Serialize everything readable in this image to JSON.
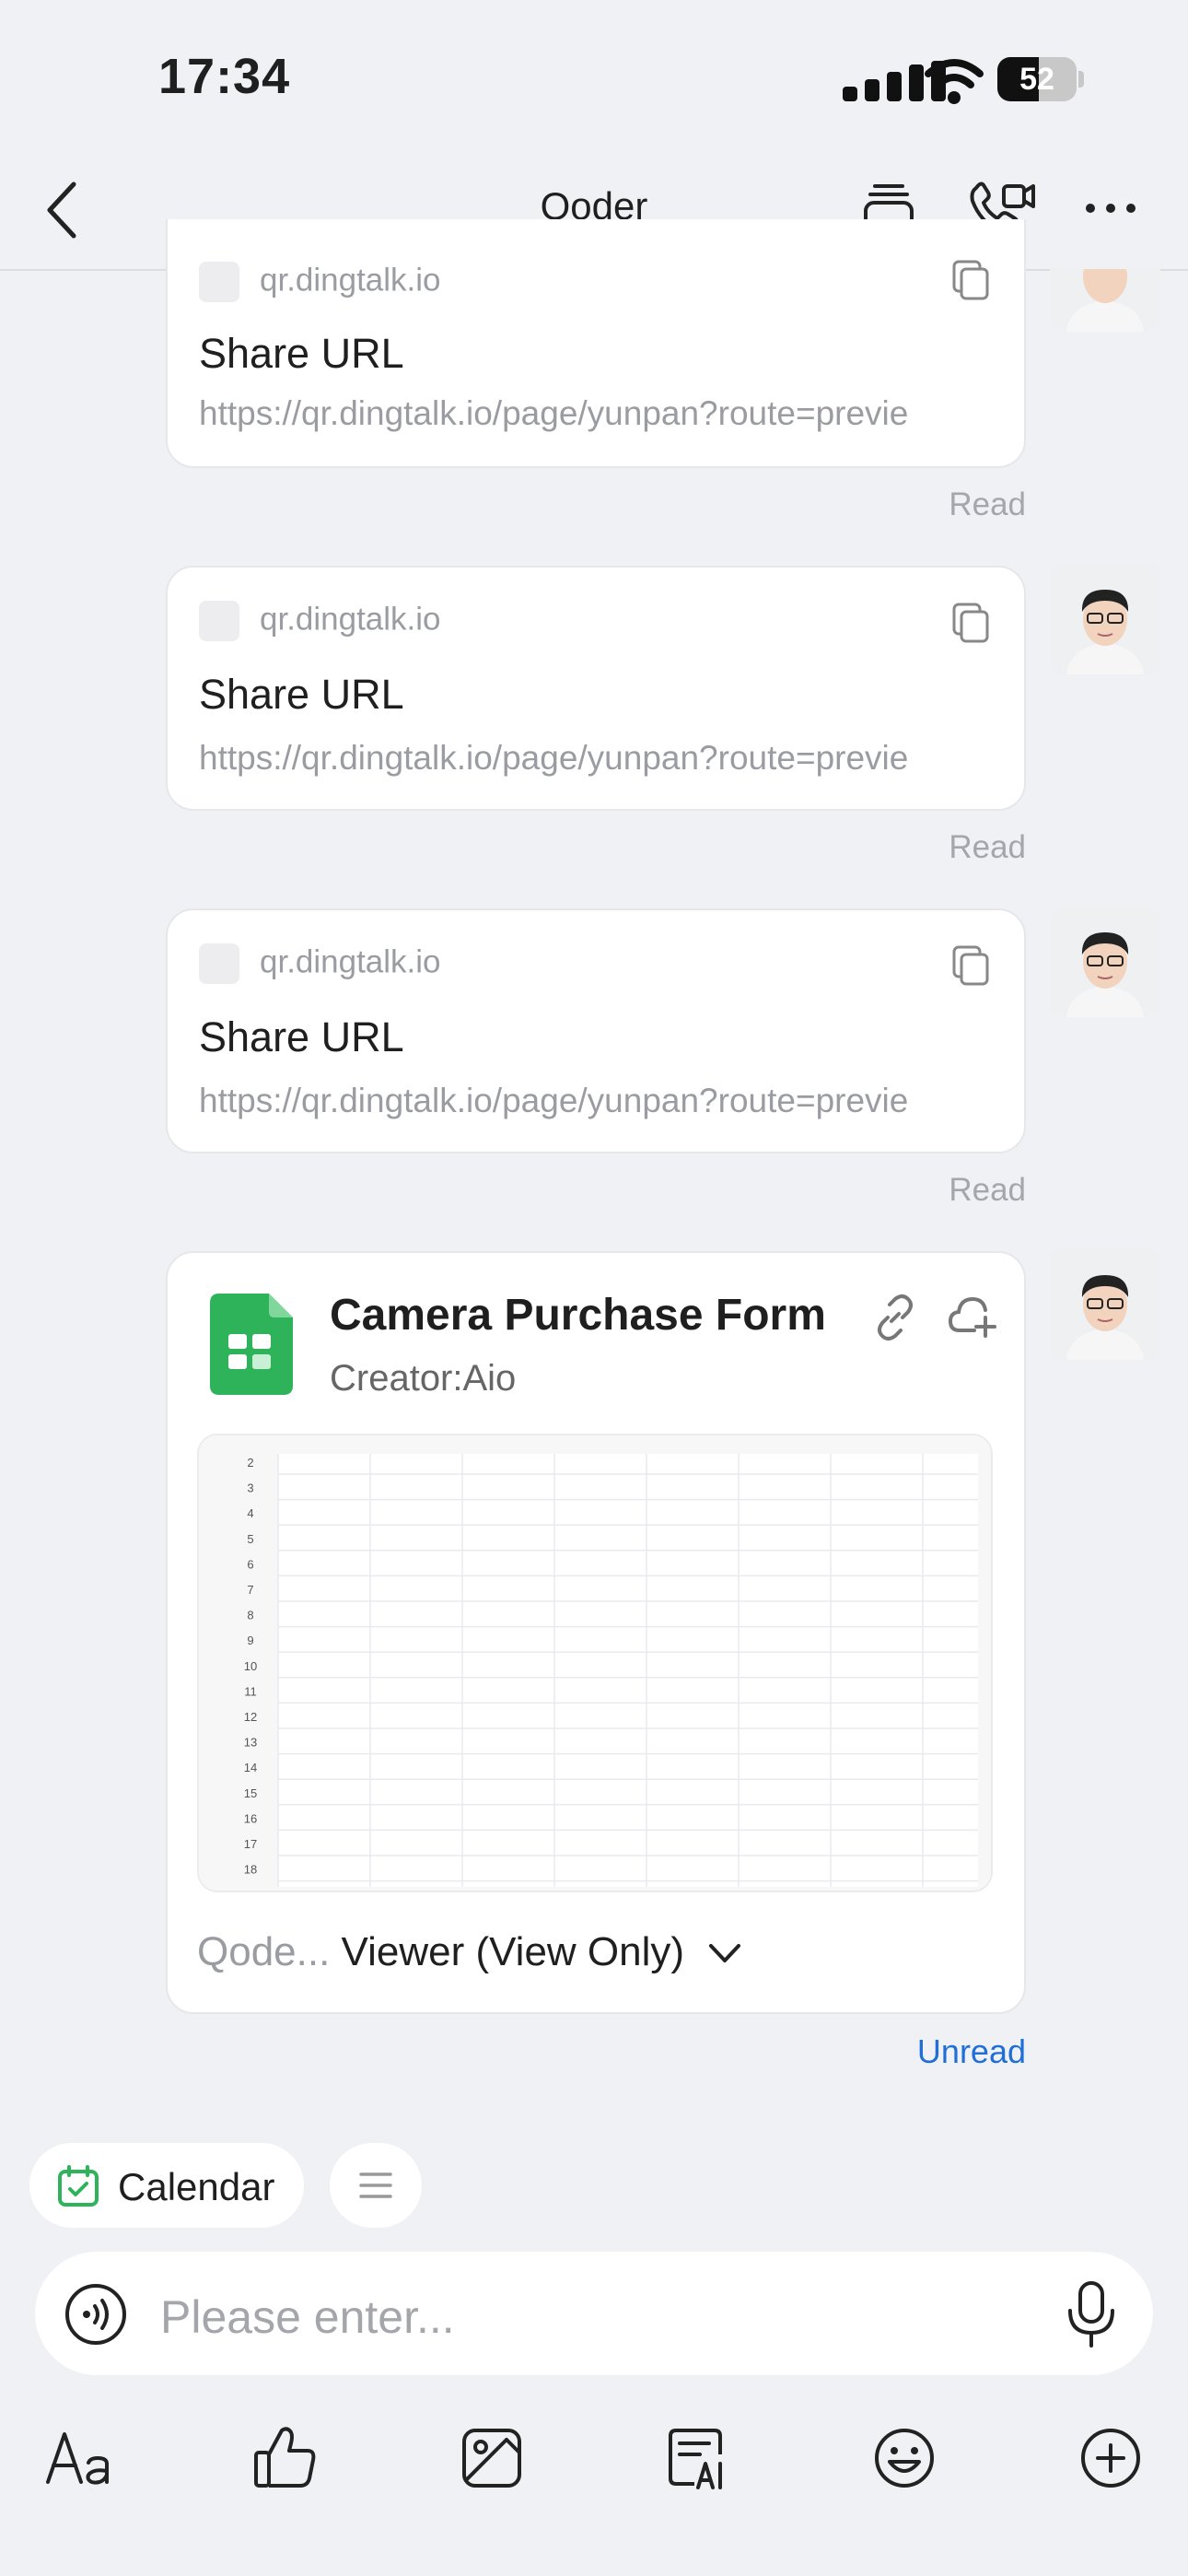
{
  "status_bar": {
    "time": "17:34",
    "battery": "52",
    "battery_level": 0.52
  },
  "nav": {
    "title": "Qoder",
    "icons": [
      "back-icon",
      "stack-icon",
      "video-call-icon",
      "more-icon"
    ]
  },
  "messages": [
    {
      "domain": "qr.dingtalk.io",
      "title": "Share URL",
      "url": "https://qr.dingtalk.io/page/yunpan?route=previe",
      "status": "Read"
    },
    {
      "domain": "qr.dingtalk.io",
      "title": "Share URL",
      "url": "https://qr.dingtalk.io/page/yunpan?route=previe",
      "status": "Read"
    },
    {
      "domain": "qr.dingtalk.io",
      "title": "Share URL",
      "url": "https://qr.dingtalk.io/page/yunpan?route=previe",
      "status": "Read"
    }
  ],
  "doc_card": {
    "title": "Camera Purchase Form",
    "creator": "Creator:Aio",
    "row_numbers": [
      "2",
      "3",
      "4",
      "5",
      "6",
      "7",
      "8",
      "9",
      "10",
      "11",
      "12",
      "13",
      "14",
      "15",
      "16",
      "17",
      "18"
    ],
    "permission_owner": "Qode...",
    "permission": "Viewer (View Only)",
    "status": "Unread"
  },
  "quick_bar": {
    "calendar": "Calendar"
  },
  "input": {
    "placeholder": "Please enter..."
  },
  "toolbar": {
    "icons": [
      "text-format-icon",
      "thumbs-up-icon",
      "image-icon",
      "ai-note-icon",
      "emoji-icon",
      "add-icon"
    ]
  },
  "colors": {
    "background": "#f0f1f4",
    "accent_blue": "#1f6fd6",
    "sheet_green": "#2fb35a"
  }
}
